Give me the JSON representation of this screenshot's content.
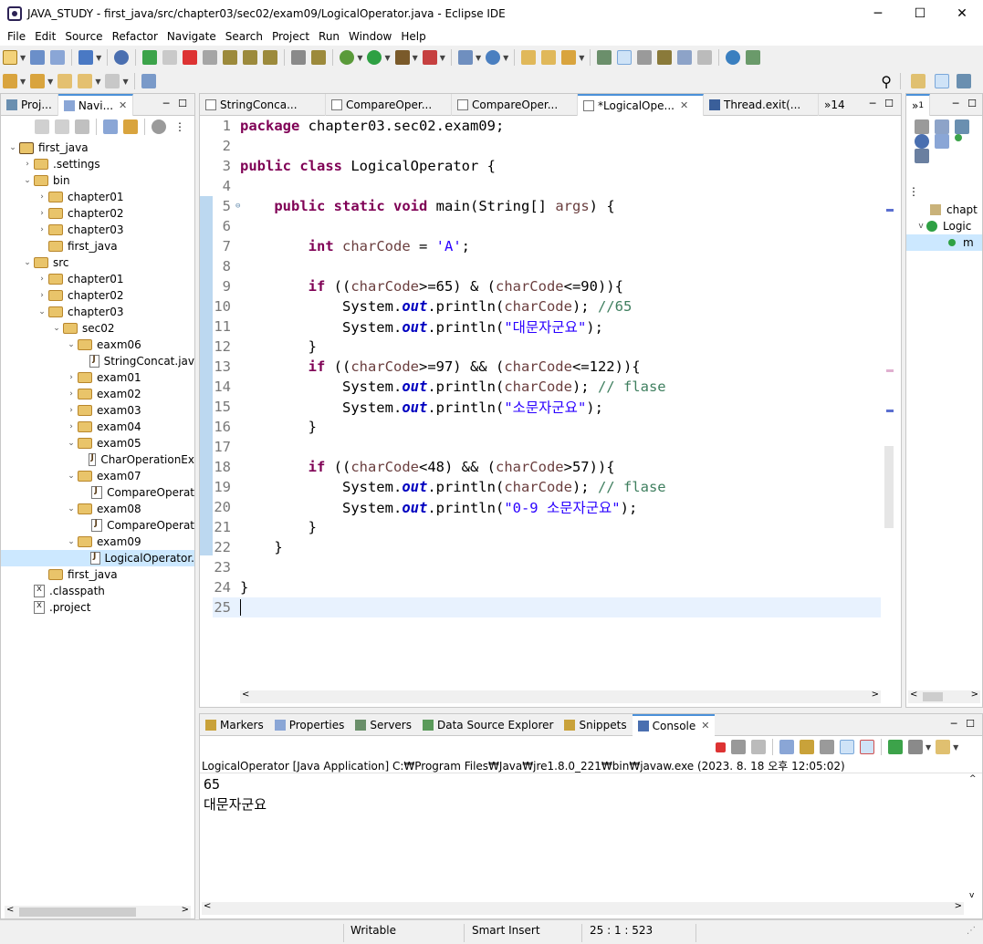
{
  "window": {
    "title": "JAVA_STUDY - first_java/src/chapter03/sec02/exam09/LogicalOperator.java - Eclipse IDE",
    "min": "─",
    "max": "☐",
    "close": "✕"
  },
  "menu": [
    "File",
    "Edit",
    "Source",
    "Refactor",
    "Navigate",
    "Search",
    "Project",
    "Run",
    "Window",
    "Help"
  ],
  "explorer": {
    "tabs": [
      {
        "label": "Proj...",
        "active": false
      },
      {
        "label": "Navi...",
        "active": true
      }
    ],
    "tree": [
      {
        "label": "first_java",
        "type": "project",
        "depth": 0,
        "twist": "v"
      },
      {
        "label": ".settings",
        "type": "folder",
        "depth": 1,
        "twist": ">"
      },
      {
        "label": "bin",
        "type": "folder",
        "depth": 1,
        "twist": "v"
      },
      {
        "label": "chapter01",
        "type": "folder",
        "depth": 2,
        "twist": ">"
      },
      {
        "label": "chapter02",
        "type": "folder",
        "depth": 2,
        "twist": ">"
      },
      {
        "label": "chapter03",
        "type": "folder",
        "depth": 2,
        "twist": ">"
      },
      {
        "label": "first_java",
        "type": "folder",
        "depth": 2,
        "twist": ""
      },
      {
        "label": "src",
        "type": "folder",
        "depth": 1,
        "twist": "v"
      },
      {
        "label": "chapter01",
        "type": "folder",
        "depth": 2,
        "twist": ">"
      },
      {
        "label": "chapter02",
        "type": "folder",
        "depth": 2,
        "twist": ">"
      },
      {
        "label": "chapter03",
        "type": "folder",
        "depth": 2,
        "twist": "v"
      },
      {
        "label": "sec02",
        "type": "folder",
        "depth": 3,
        "twist": "v"
      },
      {
        "label": "eaxm06",
        "type": "folder",
        "depth": 4,
        "twist": "v"
      },
      {
        "label": "StringConcat.jav",
        "type": "java",
        "depth": 5,
        "twist": ""
      },
      {
        "label": "exam01",
        "type": "folder",
        "depth": 4,
        "twist": ">"
      },
      {
        "label": "exam02",
        "type": "folder",
        "depth": 4,
        "twist": ">"
      },
      {
        "label": "exam03",
        "type": "folder",
        "depth": 4,
        "twist": ">"
      },
      {
        "label": "exam04",
        "type": "folder",
        "depth": 4,
        "twist": ">"
      },
      {
        "label": "exam05",
        "type": "folder",
        "depth": 4,
        "twist": "v"
      },
      {
        "label": "CharOperationEx",
        "type": "java",
        "depth": 5,
        "twist": ""
      },
      {
        "label": "exam07",
        "type": "folder",
        "depth": 4,
        "twist": "v"
      },
      {
        "label": "CompareOperat",
        "type": "java",
        "depth": 5,
        "twist": ""
      },
      {
        "label": "exam08",
        "type": "folder",
        "depth": 4,
        "twist": "v"
      },
      {
        "label": "CompareOperat",
        "type": "java",
        "depth": 5,
        "twist": ""
      },
      {
        "label": "exam09",
        "type": "folder",
        "depth": 4,
        "twist": "v"
      },
      {
        "label": "LogicalOperator.",
        "type": "java",
        "depth": 5,
        "twist": "",
        "selected": true
      },
      {
        "label": "first_java",
        "type": "folder",
        "depth": 2,
        "twist": ""
      },
      {
        "label": ".classpath",
        "type": "xfile",
        "depth": 1,
        "twist": ""
      },
      {
        "label": ".project",
        "type": "xfile",
        "depth": 1,
        "twist": ""
      }
    ]
  },
  "editor": {
    "tabs": [
      {
        "label": "StringConca...",
        "active": false
      },
      {
        "label": "CompareOper...",
        "active": false
      },
      {
        "label": "CompareOper...",
        "active": false
      },
      {
        "label": "*LogicalOpe...",
        "active": true
      },
      {
        "label": "Thread.exit(...",
        "active": false
      }
    ],
    "overflow": "»14",
    "current_line": 25,
    "lines": [
      [
        [
          "kw",
          "package"
        ],
        [
          "",
          " chapter03.sec02.exam09;"
        ]
      ],
      [],
      [
        [
          "kw",
          "public"
        ],
        [
          "",
          " "
        ],
        [
          "kw",
          "class"
        ],
        [
          "",
          " LogicalOperator {"
        ]
      ],
      [],
      [
        [
          "",
          "    "
        ],
        [
          "kw",
          "public"
        ],
        [
          "",
          " "
        ],
        [
          "kw",
          "static"
        ],
        [
          "",
          " "
        ],
        [
          "kw",
          "void"
        ],
        [
          "",
          " main(String[] "
        ],
        [
          "var",
          "args"
        ],
        [
          "",
          ") {"
        ]
      ],
      [],
      [
        [
          "",
          "        "
        ],
        [
          "kw",
          "int"
        ],
        [
          "",
          " "
        ],
        [
          "var",
          "charCode"
        ],
        [
          "",
          " = "
        ],
        [
          "str",
          "'A'"
        ],
        [
          "",
          ";"
        ]
      ],
      [],
      [
        [
          "",
          "        "
        ],
        [
          "kw",
          "if"
        ],
        [
          "",
          " (("
        ],
        [
          "var",
          "charCode"
        ],
        [
          "",
          ">=65) & ("
        ],
        [
          "var",
          "charCode"
        ],
        [
          "",
          "<=90)){"
        ]
      ],
      [
        [
          "",
          "            System."
        ],
        [
          "fld",
          "out"
        ],
        [
          "",
          ".println("
        ],
        [
          "var",
          "charCode"
        ],
        [
          "",
          "); "
        ],
        [
          "cmt",
          "//65"
        ]
      ],
      [
        [
          "",
          "            System."
        ],
        [
          "fld",
          "out"
        ],
        [
          "",
          ".println("
        ],
        [
          "str",
          "\"대문자군요\""
        ],
        [
          "",
          ");"
        ]
      ],
      [
        [
          "",
          "        }"
        ]
      ],
      [
        [
          "",
          "        "
        ],
        [
          "kw",
          "if"
        ],
        [
          "",
          " (("
        ],
        [
          "var",
          "charCode"
        ],
        [
          "",
          ">=97) && ("
        ],
        [
          "var",
          "charCode"
        ],
        [
          "",
          "<=122)){"
        ]
      ],
      [
        [
          "",
          "            System."
        ],
        [
          "fld",
          "out"
        ],
        [
          "",
          ".println("
        ],
        [
          "var",
          "charCode"
        ],
        [
          "",
          "); "
        ],
        [
          "cmt",
          "// flase"
        ]
      ],
      [
        [
          "",
          "            System."
        ],
        [
          "fld",
          "out"
        ],
        [
          "",
          ".println("
        ],
        [
          "str",
          "\"소문자군요\""
        ],
        [
          "",
          ");"
        ]
      ],
      [
        [
          "",
          "        }"
        ]
      ],
      [],
      [
        [
          "",
          "        "
        ],
        [
          "kw",
          "if"
        ],
        [
          "",
          " (("
        ],
        [
          "var",
          "charCode"
        ],
        [
          "",
          "<48) && ("
        ],
        [
          "var",
          "charCode"
        ],
        [
          "",
          ">57)){"
        ]
      ],
      [
        [
          "",
          "            System."
        ],
        [
          "fld",
          "out"
        ],
        [
          "",
          ".println("
        ],
        [
          "var",
          "charCode"
        ],
        [
          "",
          "); "
        ],
        [
          "cmt",
          "// flase"
        ]
      ],
      [
        [
          "",
          "            System."
        ],
        [
          "fld",
          "out"
        ],
        [
          "",
          ".println("
        ],
        [
          "str",
          "\"0-9 소문자군요\""
        ],
        [
          "",
          ");"
        ]
      ],
      [
        [
          "",
          "        }"
        ]
      ],
      [
        [
          "",
          "    }"
        ]
      ],
      [],
      [
        [
          "",
          "}"
        ]
      ],
      []
    ]
  },
  "outline": {
    "tab_label": "1",
    "items": [
      {
        "label": "chapt"
      },
      {
        "label": "Logic"
      },
      {
        "label": "m"
      }
    ]
  },
  "bottom": {
    "tabs": [
      {
        "label": "Markers",
        "active": false
      },
      {
        "label": "Properties",
        "active": false
      },
      {
        "label": "Servers",
        "active": false
      },
      {
        "label": "Data Source Explorer",
        "active": false
      },
      {
        "label": "Snippets",
        "active": false
      },
      {
        "label": "Console",
        "active": true
      }
    ],
    "console_header": "LogicalOperator [Java Application] C:₩Program Files₩Java₩jre1.8.0_221₩bin₩javaw.exe  (2023. 8. 18 오후 12:05:02)",
    "output": [
      "65",
      "대문자군요"
    ]
  },
  "status": {
    "writable": "Writable",
    "insert_mode": "Smart Insert",
    "position": "25 : 1 : 523"
  }
}
